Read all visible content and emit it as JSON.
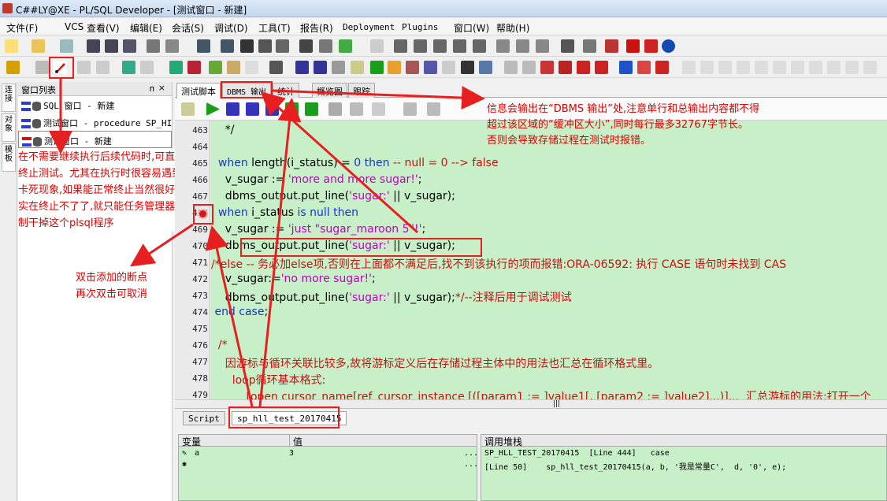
{
  "window": {
    "title": "C##LY@XE - PL/SQL Developer - [测试窗口 - 新建]"
  },
  "menu": [
    "文件(F)",
    "VCS",
    "查看(V)",
    "编辑(E)",
    "会话(S)",
    "调试(D)",
    "工具(T)",
    "报告(R)",
    "Deployment",
    "Plugins",
    "窗口(W)",
    "帮助(H)"
  ],
  "sidebar": {
    "vtabs": [
      "连接",
      "对象",
      "模板"
    ],
    "header": "窗口列表",
    "pin": "ᴨ",
    "close": "×",
    "items": [
      "SQL 窗口 - 新建",
      "测试窗口 - procedure SP_HI",
      "测试窗口 - 新建"
    ]
  },
  "annotations": {
    "stop_note": "在不需要继续执行后续代码时,可直接终止测试。尤其在执行时很容易遇到卡死现象,如果能正常终止当然很好,实在终止不了了,就只能任务管理器强制干掉这个plsql程序",
    "breakpoint_line1": "双击添加的断点",
    "breakpoint_line2": "再次双击可取消",
    "dbms_line1": "信息会输出在“DBMS 输出”处,注意单行和总输出内容都不得",
    "dbms_line2": "超过该区域的“缓冲区大小”,同时每行最多32767字节长。",
    "dbms_line3": "否则会导致存储过程在测试时报错。"
  },
  "tabs": [
    "测试脚本",
    "DBMS 输出",
    "统计",
    "概览图",
    "跟踪"
  ],
  "code": {
    "line_numbers": [
      "463",
      "464",
      "465",
      "466",
      "467",
      "468",
      "469",
      "470",
      "471",
      "472",
      "473",
      "474",
      "475",
      "476",
      "477",
      "478",
      "479"
    ],
    "l463": "    */",
    "l465a": "  when ",
    "l465b": "length(i_status) = ",
    "l465c": "0",
    "l465d": " then ",
    "l465e": "-- null = 0 --> false",
    "l466a": "    v_sugar := ",
    "l466b": "'more and more sugar!'",
    "l466c": ";",
    "l467a": "    dbms_output.put_line(",
    "l467b": "'sugar:'",
    "l467c": " || v_sugar);",
    "l468a": "  when ",
    "l468b": "i_status ",
    "l468c": "is null then",
    "l469a": "    v_sugar := ",
    "l469b": "'just \"sugar_maroon 5\"!'",
    "l469c": ";",
    "l470a": "    dbms_output.put_line(",
    "l470b": "'sugar:'",
    "l470c": " || v_sugar);",
    "l471": "/*else -- 务必加else项,否则在上面都不满足后,找不到该执行的项而报错:ORA-06592: 执行 CASE 语句时未找到 CAS",
    "l472a": "    v_sugar:=",
    "l472b": "'no more sugar!'",
    "l472c": ";",
    "l473a": "    dbms_output.put_line(",
    "l473b": "'sugar:'",
    "l473c": " || v_sugar);",
    "l473d": "*/--注释后用于调试测试",
    "l474a": " end ",
    "l474b": "case",
    ";": ";",
    "l476": "  /*",
    "l477": "    因游标与循环关联比较多,故将游标定义后在存储过程主体中的用法也汇总在循环格式里。",
    "l478": "      loop循环基本格式:",
    "l479": "          [open cursor_name[ref_cursor_instance [([param1 := ]value1[, [param2 := ]value2]...)]...  汇总游标的用法:打开一个"
  },
  "scroll_mark": "|||",
  "bottom_tabs": [
    "Script",
    "sp_hll_test_20170415"
  ],
  "vars": {
    "col_var": "变量",
    "col_val": "值",
    "rows": [
      {
        "name": "a",
        "value": "3"
      },
      {
        "name": "",
        "value": ""
      }
    ],
    "ellipsis": "..."
  },
  "stack": {
    "header": "调用堆栈",
    "rows": [
      "SP_HLL_TEST_20170415  [Line 444]   case",
      "[Line 50]    sp_hll_test_20170415(a, b, '我是常量C',  d, '0', e);"
    ]
  },
  "colors": {
    "code_bg": "#c8f0c8",
    "annotation_red": "#e00000",
    "keyword": "#1a35c8",
    "string": "#c000c0"
  }
}
